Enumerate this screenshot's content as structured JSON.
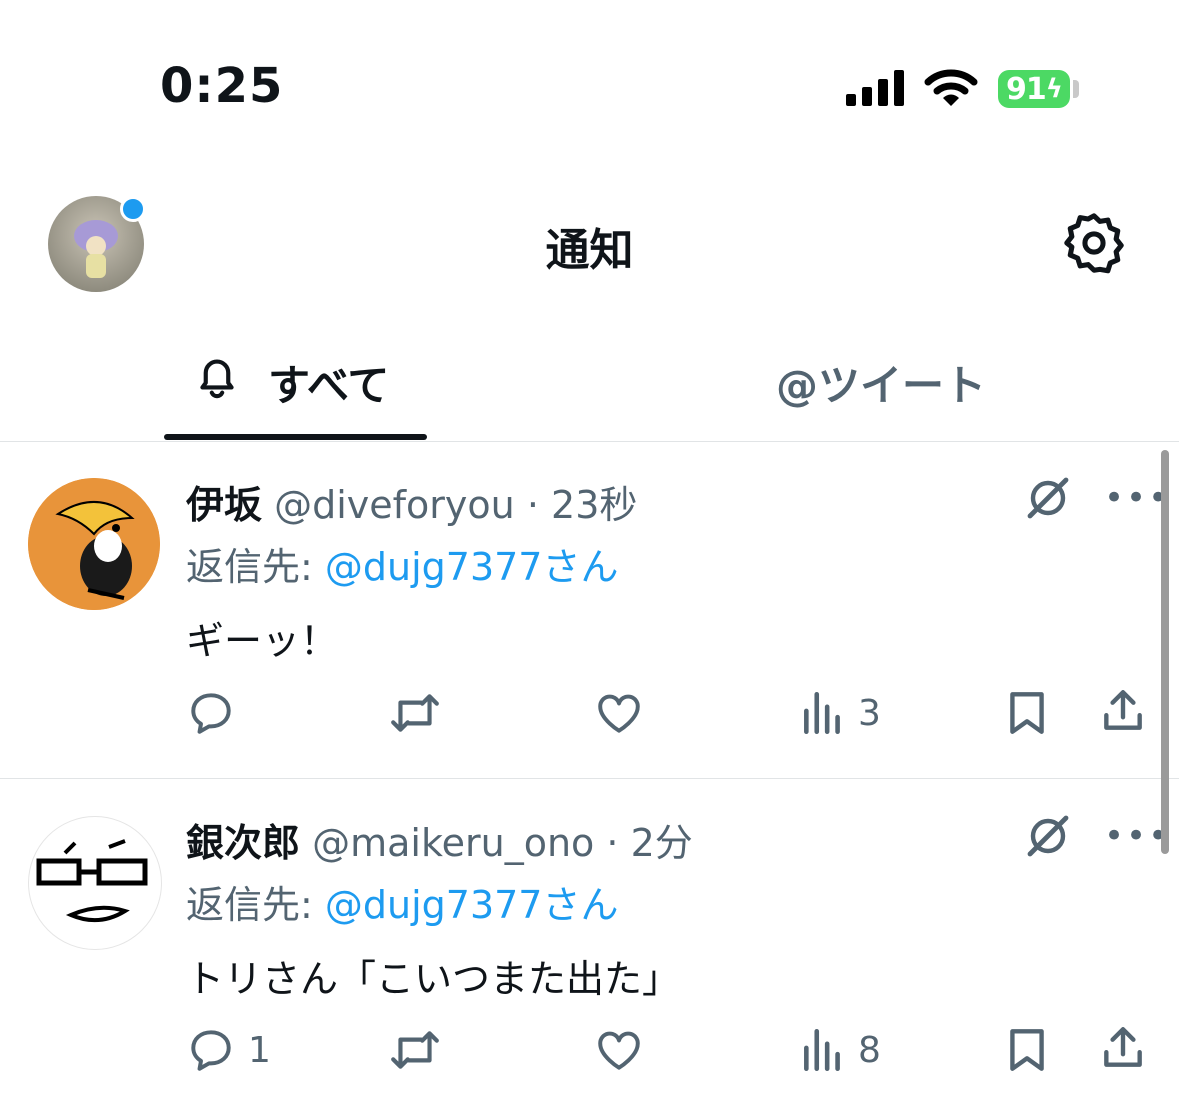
{
  "status_bar": {
    "time": "0:25",
    "battery": "91"
  },
  "header": {
    "title": "通知"
  },
  "tabs": {
    "all": "すべて",
    "tweets": "@ツイート"
  },
  "tweets": [
    {
      "name": "伊坂",
      "handle": "@diveforyou",
      "sep": "·",
      "time": "23秒",
      "reply_prefix": "返信先: ",
      "reply_to": "@dujg7377さん",
      "text": "ギーッ！",
      "reply_count": "",
      "views": "3"
    },
    {
      "name": "銀次郎",
      "handle": "@maikeru_ono",
      "sep": "·",
      "time": "2分",
      "reply_prefix": "返信先: ",
      "reply_to": "@dujg7377さん",
      "text": "トリさん「こいつまた出た」",
      "reply_count": "1",
      "views": "8"
    }
  ],
  "colors": {
    "accent": "#1d9bf0",
    "secondary_text": "#536471",
    "battery": "#4cd964"
  }
}
